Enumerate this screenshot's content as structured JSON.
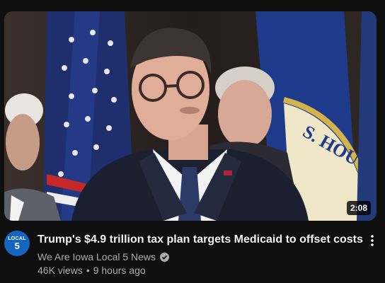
{
  "video": {
    "duration": "2:08",
    "title": "Trump's $4.9 trillion tax plan targets Medicaid to offset costs"
  },
  "channel": {
    "name": "We Are Iowa Local 5 News",
    "avatar_line1": "LOCAL",
    "avatar_line2": "5",
    "verified": true,
    "avatar_color": "#1565c0"
  },
  "stats": {
    "views": "46K views",
    "separator": "•",
    "age": "9 hours ago"
  },
  "icons": {
    "verified": "check-circle-icon",
    "more": "three-dots-vertical-icon"
  }
}
